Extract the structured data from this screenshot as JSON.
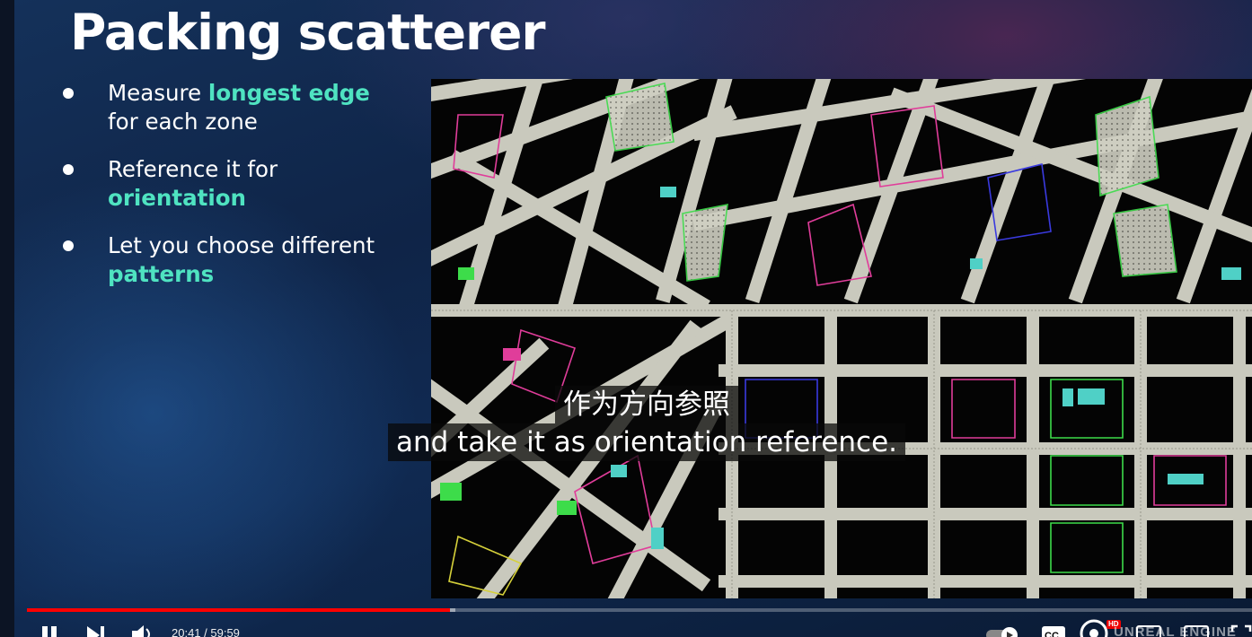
{
  "slide": {
    "title": "Packing scatterer",
    "bullets": [
      {
        "before": "Measure ",
        "highlight": "longest edge",
        "after": " for each zone"
      },
      {
        "before": "Reference it for ",
        "highlight": "orientation",
        "after": ""
      },
      {
        "before": "Let you choose different ",
        "highlight": "patterns",
        "after": ""
      }
    ]
  },
  "subtitles": {
    "line_zh": "作为方向参照",
    "line_en": "and take it as orientation reference."
  },
  "player": {
    "current_time": "20:41",
    "duration": "59:59",
    "time_display": "20:41 / 59:59",
    "played_fraction": 0.345,
    "buffered_fraction": 0.35,
    "hd_badge": "HD",
    "watermark": "UNREAL ENGINE"
  },
  "colors": {
    "accent_highlight": "#4fe3c1",
    "progress_played": "#ff0000",
    "road": "#c9c9bd"
  },
  "icons": [
    "pause-icon",
    "next-icon",
    "volume-icon",
    "autoplay-toggle-icon",
    "captions-icon",
    "settings-icon",
    "miniplayer-icon",
    "theater-icon",
    "fullscreen-icon"
  ]
}
